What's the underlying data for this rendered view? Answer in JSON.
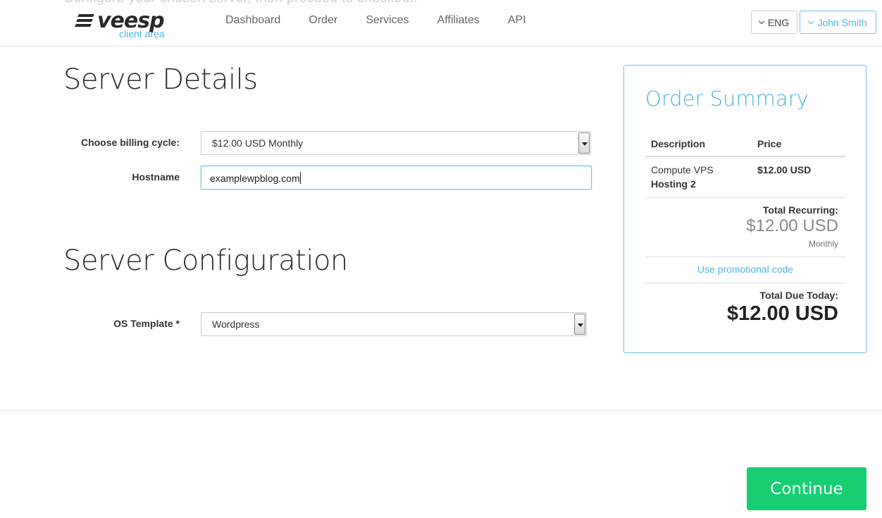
{
  "header": {
    "ghost_text": "Configure your chosen server, then proceed to checkout.",
    "logo_text": "veesp",
    "logo_sub": "client area",
    "nav": [
      "Dashboard",
      "Order",
      "Services",
      "Affiliates",
      "API"
    ],
    "lang": "ENG",
    "user": "John Smith"
  },
  "server_details": {
    "title": "Server Details",
    "billing_label": "Choose billing cycle:",
    "billing_value": "$12.00 USD Monthly",
    "hostname_label": "Hostname",
    "hostname_value": "examplewpblog.com"
  },
  "server_config": {
    "title": "Server Configuration",
    "os_label": "OS Template *",
    "os_value": "Wordpress"
  },
  "summary": {
    "title": "Order Summary",
    "col_description": "Description",
    "col_price": "Price",
    "item_line1": "Compute VPS",
    "item_line2": "Hosting 2",
    "item_price": "$12.00 USD",
    "recurring_label": "Total Recurring:",
    "recurring_amount": "$12.00 USD",
    "recurring_period": "Monthly",
    "promo_link": "Use promotional code",
    "due_label": "Total Due Today:",
    "due_amount": "$12.00 USD"
  },
  "actions": {
    "continue": "Continue"
  },
  "colors": {
    "accent": "#4fb3e0",
    "continue": "#17cf72"
  }
}
